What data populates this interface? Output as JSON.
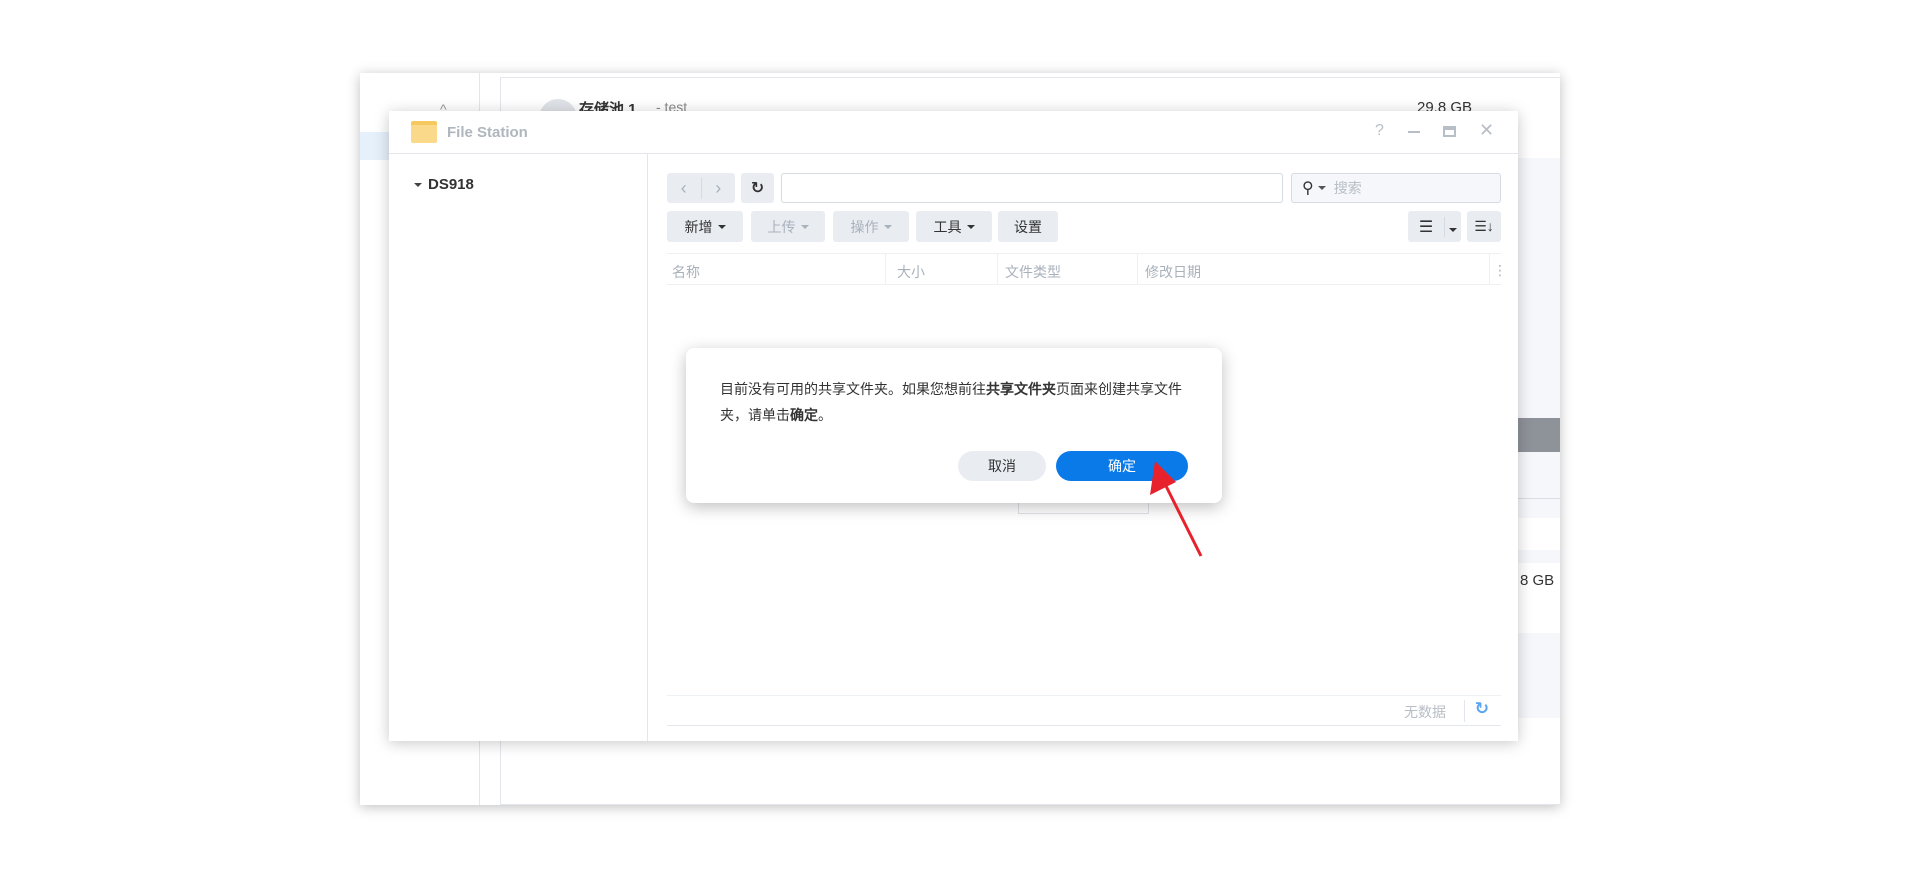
{
  "background": {
    "pool_name": "存储池 1",
    "pool_suffix": "- test",
    "pool_size": "29.8 GB",
    "partial_size": "8 GB"
  },
  "file_station": {
    "title": "File Station",
    "tree_root": "DS918",
    "path_value": "",
    "search_placeholder": "搜索",
    "toolbar": {
      "new": "新增",
      "upload": "上传",
      "action": "操作",
      "tools": "工具",
      "settings": "设置"
    },
    "columns": [
      "名称",
      "大小",
      "文件类型",
      "修改日期"
    ],
    "footer_status": "无数据"
  },
  "dialog": {
    "message_part1": "目前没有可用的共享文件夹。如果您想前往",
    "message_bold1": "共享文件夹",
    "message_part2": "页面来创建共享文件夹，请单击",
    "message_bold2": "确定",
    "message_end": "。",
    "cancel": "取消",
    "ok": "确定"
  },
  "colors": {
    "accent": "#0a7ae8",
    "annotation_arrow": "#e8222c"
  }
}
